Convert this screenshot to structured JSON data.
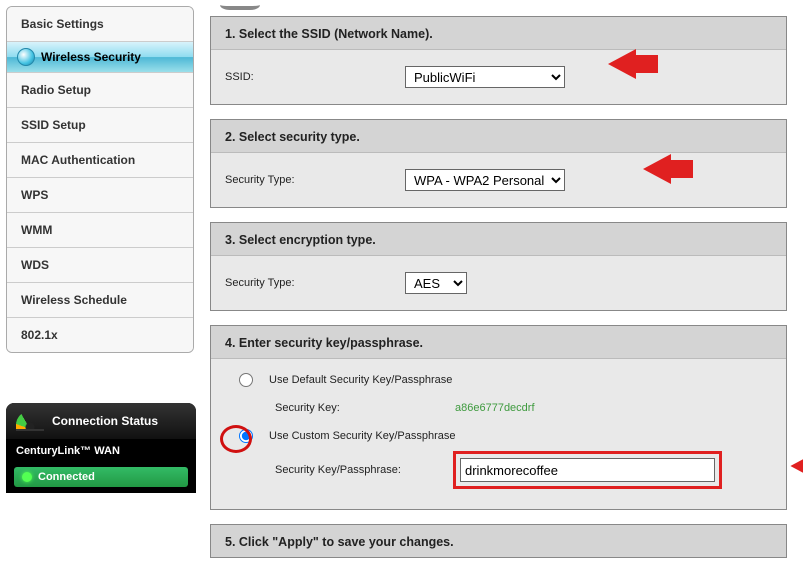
{
  "sidebar": {
    "items": [
      {
        "label": "Basic Settings"
      },
      {
        "label": "Wireless Security"
      },
      {
        "label": "Radio Setup"
      },
      {
        "label": "SSID Setup"
      },
      {
        "label": "MAC Authentication"
      },
      {
        "label": "WPS"
      },
      {
        "label": "WMM"
      },
      {
        "label": "WDS"
      },
      {
        "label": "Wireless Schedule"
      },
      {
        "label": "802.1x"
      }
    ]
  },
  "status": {
    "title": "Connection Status",
    "wan_label": "CenturyLink™ WAN",
    "state": "Connected"
  },
  "sections": {
    "s1": {
      "header": "1. Select the SSID (Network Name).",
      "ssid_label": "SSID:",
      "ssid_value": "PublicWiFi"
    },
    "s2": {
      "header": "2. Select security type.",
      "type_label": "Security Type:",
      "type_value": "WPA - WPA2 Personal"
    },
    "s3": {
      "header": "3. Select encryption type.",
      "type_label": "Security Type:",
      "enc_value": "AES"
    },
    "s4": {
      "header": "4. Enter security key/passphrase.",
      "default_label": "Use Default Security Key/Passphrase",
      "sec_key_label": "Security Key:",
      "sec_key_value": "a86e6777decdrf",
      "custom_label": "Use Custom Security Key/Passphrase",
      "pass_label": "Security Key/Passphrase:",
      "pass_value": "drinkmorecoffee"
    },
    "s5": {
      "header": "5. Click \"Apply\" to save your changes."
    }
  }
}
